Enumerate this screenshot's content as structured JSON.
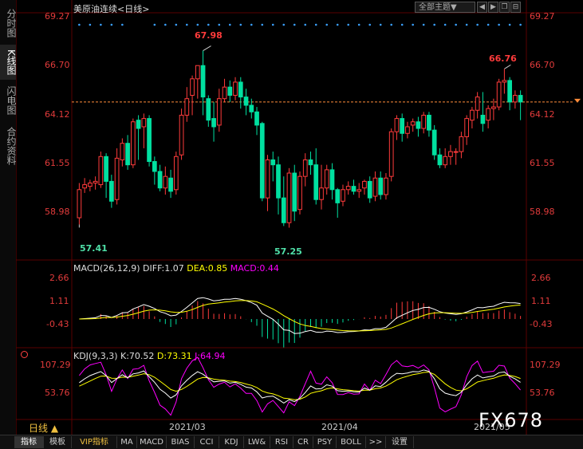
{
  "left_tabs": [
    {
      "label": "分时图",
      "active": false
    },
    {
      "label": "K线图",
      "active": true
    },
    {
      "label": "闪电图",
      "active": false
    },
    {
      "label": "合约资料",
      "active": false
    }
  ],
  "header": {
    "instrument": "美原油连续",
    "period": "<日线>",
    "theme": "全部主题▼"
  },
  "price_axis": {
    "ticks": [
      "69.27",
      "66.70",
      "64.12",
      "61.55",
      "58.98"
    ]
  },
  "annotations": {
    "high": "67.98",
    "low": "57.41",
    "low2": "57.25",
    "last_high": "66.76"
  },
  "macd": {
    "name": "MACD(26,12,9)",
    "diff": "DIFF:1.07",
    "dea": "DEA:0.85",
    "macd": "MACD:0.44",
    "ticks": [
      "2.66",
      "1.11",
      "-0.43"
    ]
  },
  "kdj": {
    "name": "KDJ(9,3,3)",
    "k": "K:70.52",
    "d": "D:73.31",
    "j": "J:64.94",
    "ticks": [
      "107.29",
      "53.76"
    ]
  },
  "dates": [
    "2021/03",
    "2021/04",
    "2021/05"
  ],
  "period_label": "日线 ▲",
  "bottom_tabs": [
    {
      "label": "指标",
      "active": true
    },
    {
      "label": "模板"
    },
    {
      "label": "VIP指标",
      "vip": true
    },
    {
      "label": "MA"
    },
    {
      "label": "MACD"
    },
    {
      "label": "BIAS"
    },
    {
      "label": "CCI"
    },
    {
      "label": "KDJ"
    },
    {
      "label": "LW&"
    },
    {
      "label": "RSI"
    },
    {
      "label": "CR"
    },
    {
      "label": "PSY"
    },
    {
      "label": "BOLL"
    },
    {
      "label": ">>"
    },
    {
      "label": "设置"
    }
  ],
  "watermark": "FX678",
  "colors": {
    "up": "#ff3b3b",
    "down": "#00e0a0",
    "dif": "#ffffff",
    "dea": "#ffff00",
    "j": "#ff00ff"
  },
  "chart_data": {
    "type": "candlestick",
    "ylim": [
      56.5,
      70.0
    ],
    "candles": [
      [
        57.8,
        59.5,
        57.4,
        59.9
      ],
      [
        59.6,
        59.8,
        59.3,
        60.2
      ],
      [
        59.7,
        59.9,
        59.4,
        60.1
      ],
      [
        59.9,
        60.0,
        59.5,
        60.3
      ],
      [
        59.8,
        61.5,
        59.6,
        61.8
      ],
      [
        61.5,
        60.0,
        59.0,
        61.7
      ],
      [
        60.0,
        58.8,
        58.4,
        60.4
      ],
      [
        58.9,
        61.4,
        58.6,
        62.0
      ],
      [
        61.3,
        62.3,
        60.9,
        62.6
      ],
      [
        62.3,
        61.0,
        60.7,
        62.8
      ],
      [
        61.0,
        63.6,
        60.8,
        63.8
      ],
      [
        63.7,
        63.2,
        61.3,
        64.0
      ],
      [
        63.3,
        63.8,
        62.0,
        64.1
      ],
      [
        63.8,
        61.2,
        60.9,
        64.0
      ],
      [
        61.2,
        60.6,
        59.8,
        61.5
      ],
      [
        60.6,
        59.6,
        59.4,
        61.0
      ],
      [
        59.6,
        60.3,
        59.2,
        60.9
      ],
      [
        60.2,
        59.4,
        59.0,
        60.7
      ],
      [
        59.5,
        61.5,
        59.2,
        61.8
      ],
      [
        61.6,
        64.0,
        61.3,
        64.4
      ],
      [
        64.0,
        65.0,
        63.6,
        65.7
      ],
      [
        65.2,
        66.2,
        64.0,
        66.4
      ],
      [
        66.2,
        67.0,
        65.0,
        67.0
      ],
      [
        67.0,
        65.1,
        64.0,
        67.9
      ],
      [
        65.0,
        63.7,
        63.3,
        65.2
      ],
      [
        63.8,
        63.3,
        62.4,
        64.8
      ],
      [
        63.4,
        65.0,
        63.0,
        65.6
      ],
      [
        65.0,
        65.7,
        64.8,
        66.2
      ],
      [
        65.7,
        65.2,
        64.8,
        66.1
      ],
      [
        65.2,
        66.0,
        64.9,
        66.3
      ],
      [
        66.0,
        65.1,
        64.4,
        66.3
      ],
      [
        65.1,
        64.6,
        64.0,
        65.6
      ],
      [
        64.6,
        64.2,
        63.8,
        65.0
      ],
      [
        64.2,
        63.4,
        62.8,
        64.5
      ],
      [
        63.5,
        59.0,
        58.8,
        63.6
      ],
      [
        59.0,
        61.3,
        58.2,
        61.6
      ],
      [
        61.3,
        61.0,
        60.0,
        61.8
      ],
      [
        61.0,
        59.0,
        58.0,
        61.5
      ],
      [
        59.0,
        57.5,
        57.3,
        60.3
      ],
      [
        57.5,
        60.5,
        57.2,
        60.8
      ],
      [
        60.5,
        58.2,
        57.6,
        61.0
      ],
      [
        58.3,
        60.3,
        58.0,
        60.6
      ],
      [
        60.3,
        61.3,
        59.7,
        61.7
      ],
      [
        61.3,
        61.0,
        60.4,
        61.8
      ],
      [
        61.0,
        58.9,
        58.6,
        62.0
      ],
      [
        58.9,
        59.6,
        58.3,
        61.0
      ],
      [
        59.6,
        60.7,
        59.2,
        61.0
      ],
      [
        60.7,
        59.5,
        58.9,
        61.1
      ],
      [
        59.5,
        58.7,
        57.8,
        59.6
      ],
      [
        58.8,
        59.5,
        58.5,
        59.8
      ],
      [
        59.5,
        59.7,
        59.2,
        60.0
      ],
      [
        59.7,
        59.4,
        59.2,
        60.1
      ],
      [
        59.4,
        59.5,
        59.0,
        59.9
      ],
      [
        59.6,
        60.0,
        59.2,
        60.1
      ],
      [
        60.0,
        59.0,
        58.7,
        60.3
      ],
      [
        59.1,
        60.2,
        58.8,
        60.6
      ],
      [
        60.2,
        59.2,
        58.9,
        60.6
      ],
      [
        59.2,
        60.2,
        58.9,
        60.5
      ],
      [
        60.3,
        63.0,
        60.0,
        63.2
      ],
      [
        63.0,
        63.8,
        62.5,
        64.0
      ],
      [
        63.8,
        62.9,
        62.4,
        64.1
      ],
      [
        62.9,
        63.3,
        62.6,
        63.6
      ],
      [
        63.4,
        63.6,
        63.0,
        63.8
      ],
      [
        63.6,
        63.2,
        62.7,
        63.9
      ],
      [
        63.2,
        64.0,
        62.9,
        64.2
      ],
      [
        64.0,
        63.1,
        62.7,
        64.2
      ],
      [
        63.1,
        61.6,
        61.3,
        63.4
      ],
      [
        61.6,
        61.0,
        60.8,
        62.0
      ],
      [
        61.0,
        61.5,
        60.8,
        62.0
      ],
      [
        61.5,
        61.8,
        61.0,
        62.2
      ],
      [
        61.8,
        61.8,
        61.0,
        62.0
      ],
      [
        61.8,
        62.7,
        61.4,
        63.0
      ],
      [
        62.7,
        63.8,
        62.2,
        64.0
      ],
      [
        63.7,
        64.3,
        63.2,
        64.5
      ],
      [
        64.3,
        65.1,
        63.8,
        65.4
      ],
      [
        64.0,
        63.5,
        63.0,
        65.4
      ],
      [
        63.7,
        64.4,
        63.2,
        64.6
      ],
      [
        64.4,
        64.5,
        63.7,
        65.0
      ],
      [
        64.5,
        66.0,
        64.3,
        66.2
      ],
      [
        66.0,
        66.1,
        65.3,
        66.8
      ],
      [
        66.1,
        64.8,
        64.3,
        66.3
      ],
      [
        64.8,
        65.2,
        64.4,
        65.5
      ],
      [
        65.2,
        64.8,
        63.7,
        65.5
      ]
    ],
    "grid": false
  }
}
